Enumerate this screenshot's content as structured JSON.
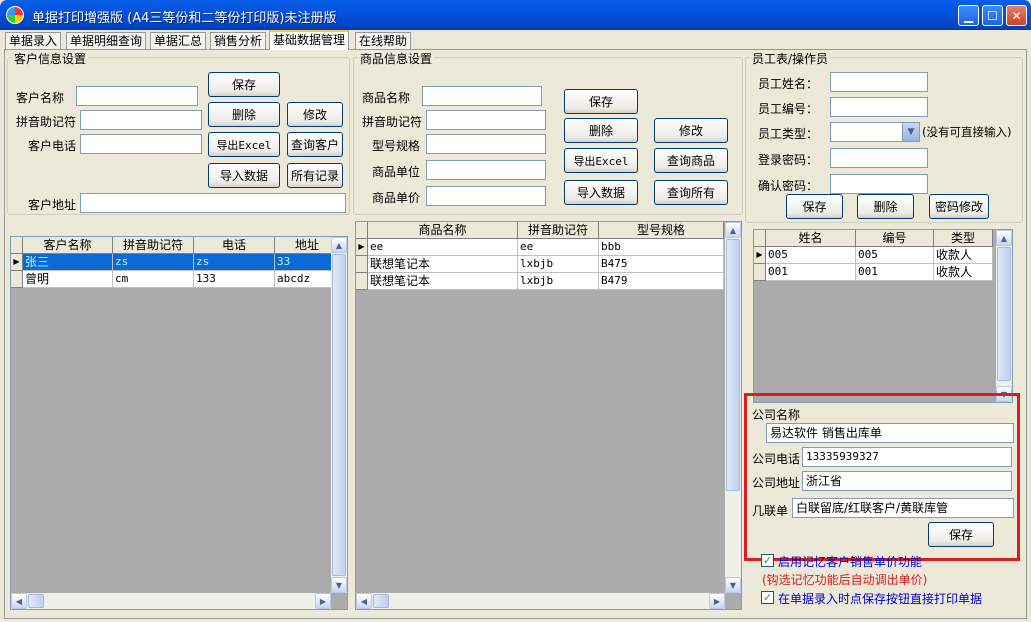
{
  "window": {
    "title": "单据打印增强版 (A4三等份和二等份打印版)未注册版"
  },
  "tabs": [
    "单据录入",
    "单据明细查询",
    "单据汇总",
    "销售分析",
    "基础数据管理",
    "在线帮助"
  ],
  "active_tab": "基础数据管理",
  "customer": {
    "group_title": "客户信息设置",
    "labels": {
      "name": "客户名称",
      "pinyin": "拼音助记符",
      "phone": "客户电话",
      "address": "客户地址"
    },
    "buttons": {
      "save": "保存",
      "delete": "删除",
      "edit": "修改",
      "export": "导出Excel",
      "query": "查询客户",
      "import": "导入数据",
      "all": "所有记录"
    },
    "grid": {
      "columns": [
        "客户名称",
        "拼音助记符",
        "电话",
        "地址"
      ],
      "rows": [
        [
          "张三",
          "zs",
          "zs",
          "33"
        ],
        [
          "曾明",
          "cm",
          "133",
          "abcdz"
        ]
      ]
    }
  },
  "product": {
    "group_title": "商品信息设置",
    "labels": {
      "name": "商品名称",
      "pinyin": "拼音助记符",
      "model": "型号规格",
      "unit": "商品单位",
      "price": "商品单价"
    },
    "buttons": {
      "save": "保存",
      "delete": "删除",
      "edit": "修改",
      "export": "导出Excel",
      "query": "查询商品",
      "import": "导入数据",
      "all": "查询所有"
    },
    "grid": {
      "columns": [
        "商品名称",
        "拼音助记符",
        "型号规格"
      ],
      "rows": [
        [
          "ee",
          "ee",
          "bbb"
        ],
        [
          "联想笔记本",
          "lxbjb",
          "B475"
        ],
        [
          "联想笔记本",
          "lxbjb",
          "B479"
        ]
      ]
    }
  },
  "employee": {
    "group_title": "员工表/操作员",
    "labels": {
      "name": "员工姓名：",
      "id": "员工编号：",
      "type": "员工类型：",
      "password": "登录密码：",
      "confirm": "确认密码："
    },
    "type_hint": "(没有可直接输入)",
    "buttons": {
      "save": "保存",
      "delete": "删除",
      "change_pw": "密码修改"
    },
    "grid": {
      "columns": [
        "姓名",
        "编号",
        "类型"
      ],
      "rows": [
        [
          "005",
          "005",
          "收款人"
        ],
        [
          "001",
          "001",
          "收款人"
        ]
      ]
    }
  },
  "company": {
    "labels": {
      "name": "公司名称",
      "phone": "公司电话",
      "address": "公司地址",
      "copies": "几联单"
    },
    "values": {
      "name": "易达软件 销售出库单",
      "phone": "13335939327",
      "address": "浙江省",
      "copies": "白联留底/红联客户/黄联库管"
    },
    "save_button": "保存"
  },
  "options": {
    "remember_price": "启用记忆客户销售单价功能",
    "remember_hint": "(钩选记忆功能后自动调出单价)",
    "direct_print": "在单据录入时点保存按钮直接打印单据"
  },
  "colors": {
    "selected_row": "#0A6BD8",
    "highlight_box": "#D42020",
    "hint_text": "#D42020",
    "option_text": "#0000C8"
  }
}
